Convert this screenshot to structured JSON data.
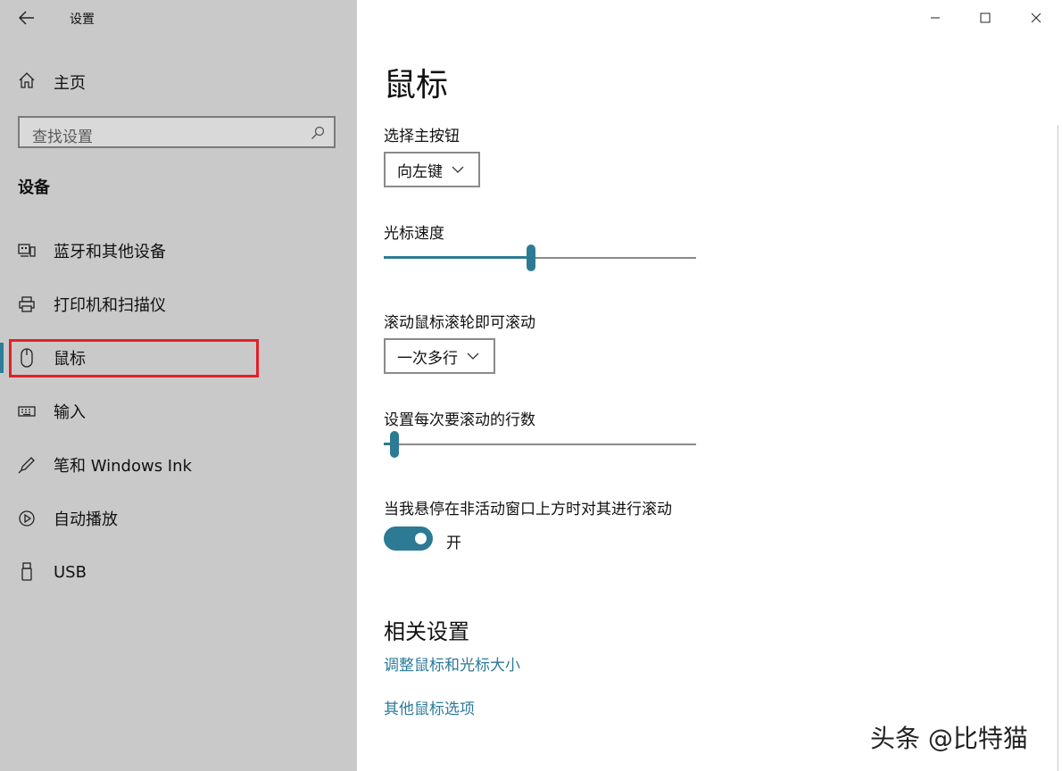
{
  "window": {
    "title": "设置",
    "controls": [
      "minimize",
      "maximize",
      "close"
    ]
  },
  "sidebar": {
    "home_label": "主页",
    "search_placeholder": "查找设置",
    "section_heading": "设备",
    "items": [
      {
        "label": "蓝牙和其他设备",
        "icon": "bluetooth-devices-icon"
      },
      {
        "label": "打印机和扫描仪",
        "icon": "printer-icon"
      },
      {
        "label": "鼠标",
        "icon": "mouse-icon",
        "active": true
      },
      {
        "label": "输入",
        "icon": "keyboard-icon"
      },
      {
        "label": "笔和 Windows Ink",
        "icon": "pen-icon"
      },
      {
        "label": "自动播放",
        "icon": "autoplay-icon"
      },
      {
        "label": "USB",
        "icon": "usb-icon"
      }
    ]
  },
  "main": {
    "title": "鼠标",
    "primary_button": {
      "label": "选择主按钮",
      "value": "向左键"
    },
    "cursor_speed": {
      "label": "光标速度",
      "value_fraction": 0.47
    },
    "wheel_scroll": {
      "label": "滚动鼠标滚轮即可滚动",
      "value": "一次多行"
    },
    "lines_per_scroll": {
      "label": "设置每次要滚动的行数",
      "value_fraction": 0.02
    },
    "inactive_scroll": {
      "label": "当我悬停在非活动窗口上方时对其进行滚动",
      "state": "开",
      "on": true
    },
    "related": {
      "heading": "相关设置",
      "links": [
        "调整鼠标和光标大小",
        "其他鼠标选项"
      ]
    }
  },
  "watermark": "头条 @比特猫",
  "colors": {
    "accent": "#2d7a94",
    "link": "#2c7a9a",
    "highlight": "#e3202a",
    "sidebar_bg": "#c9c9c9"
  }
}
